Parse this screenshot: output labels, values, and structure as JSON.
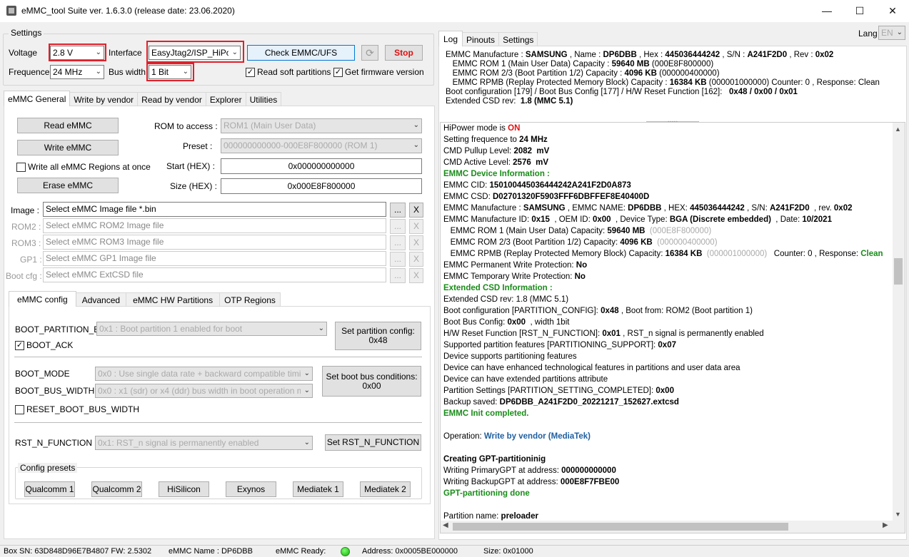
{
  "window": {
    "title": "eMMC_tool Suite  ver. 1.6.3.0 (release date: 23.06.2020)",
    "minimize": "—",
    "maximize": "☐",
    "close": "✕"
  },
  "settings": {
    "legend": "Settings",
    "voltage_label": "Voltage",
    "voltage_value": "2.8 V",
    "interface_label": "Interface",
    "interface_value": "EasyJtag2/ISP_HiPow",
    "check_button": "Check EMMC/UFS",
    "stop_button": "Stop",
    "frequence_label": "Frequence",
    "frequence_value": "24 MHz",
    "bus_width_label": "Bus width",
    "bus_width_value": "1 Bit",
    "read_soft_partitions": "Read soft partitions",
    "get_firmware_version": "Get firmware version"
  },
  "main_tabs": [
    "eMMC General",
    "Write by vendor",
    "Read by vendor",
    "Explorer",
    "Utilities"
  ],
  "general": {
    "read_button": "Read eMMC",
    "write_button": "Write eMMC",
    "write_all_regions": "Write all eMMC Regions at once",
    "erase_button": "Erase eMMC",
    "rom_label": "ROM to access :",
    "rom_value": "ROM1 (Main User Data)",
    "preset_label": "Preset :",
    "preset_value": "000000000000-000E8F800000 (ROM 1)",
    "start_label": "Start (HEX) :",
    "start_value": "0x000000000000",
    "size_label": "Size (HEX) :",
    "size_value": "0x000E8F800000",
    "files": [
      {
        "label": "Image :",
        "placeholder": "Select eMMC Image file *.bin"
      },
      {
        "label": "ROM2 :",
        "placeholder": "Select eMMC ROM2 Image file"
      },
      {
        "label": "ROM3 :",
        "placeholder": "Select eMMC ROM3 Image file"
      },
      {
        "label": "GP1 :",
        "placeholder": "Select eMMC GP1 Image file"
      },
      {
        "label": "Boot cfg :",
        "placeholder": "Select eMMC ExtCSD file"
      }
    ],
    "browse": "...",
    "clear": "X"
  },
  "config_tabs": [
    "eMMC config",
    "Advanced",
    "eMMC HW Partitions",
    "OTP Regions"
  ],
  "config": {
    "boot_partition_label": "BOOT_PARTITION_EN",
    "boot_partition_value": "0x1 : Boot partition 1 enabled for boot",
    "boot_ack": "BOOT_ACK",
    "set_partition_button": "Set partition config:\n0x48",
    "boot_mode_label": "BOOT_MODE",
    "boot_mode_value": "0x0 : Use single data rate + backward compatible timings in",
    "boot_bus_width_label": "BOOT_BUS_WIDTH",
    "boot_bus_width_value": "0x0 : x1 (sdr) or x4 (ddr) bus width in boot operation mode",
    "set_boot_bus_button": "Set boot bus conditions:\n0x00",
    "reset_boot_bus_width": "RESET_BOOT_BUS_WIDTH",
    "rst_n_label": "RST_N_FUNCTION",
    "rst_n_value": "0x1: RST_n signal is permanently enabled",
    "set_rst_button": "Set RST_N_FUNCTION",
    "presets_legend": "Config presets",
    "presets": [
      "Qualcomm 1",
      "Qualcomm 2",
      "HiSilicon",
      "Exynos",
      "Mediatek 1",
      "Mediatek 2"
    ]
  },
  "right_tabs": [
    "Log",
    "Pinouts",
    "Settings"
  ],
  "lang": {
    "label": "Lang",
    "value": "EN"
  },
  "summary": [
    [
      {
        "t": "EMMC Manufacture : "
      },
      {
        "t": "SAMSUNG",
        "c": "b"
      },
      {
        "t": " , Name : "
      },
      {
        "t": "DP6DBB",
        "c": "b"
      },
      {
        "t": " , Hex : "
      },
      {
        "t": "445036444242",
        "c": "b"
      },
      {
        "t": " , S/N : "
      },
      {
        "t": "A241F2D0",
        "c": "b"
      },
      {
        "t": " , Rev : "
      },
      {
        "t": "0x02",
        "c": "b"
      }
    ],
    [
      {
        "t": "   EMMC ROM 1 (Main User Data) Capacity : "
      },
      {
        "t": "59640 MB",
        "c": "b"
      },
      {
        "t": " (000E8F800000)"
      }
    ],
    [
      {
        "t": "   EMMC ROM 2/3 (Boot Partition 1/2) Capacity : "
      },
      {
        "t": "4096 KB",
        "c": "b"
      },
      {
        "t": " (000000400000)"
      }
    ],
    [
      {
        "t": "   EMMC RPMB (Replay Protected Memory Block) Capacity : "
      },
      {
        "t": "16384 KB",
        "c": "b"
      },
      {
        "t": " (000001000000) Counter: 0 , Response: Clean"
      }
    ],
    [
      {
        "t": "Boot configuration [179] / Boot Bus Config [177] / H/W Reset Function [162]: "
      },
      {
        "t": "  0x48 / 0x00 / 0x01",
        "c": "b"
      }
    ],
    [
      {
        "t": "Extended CSD rev: "
      },
      {
        "t": " 1.8 (MMC 5.1)",
        "c": "b"
      }
    ]
  ],
  "log": [
    [
      {
        "t": "HiPower mode is "
      },
      {
        "t": "ON",
        "c": "redt"
      }
    ],
    [
      {
        "t": "Setting frequence to "
      },
      {
        "t": "24 MHz",
        "c": "b"
      }
    ],
    [
      {
        "t": "CMD Pullup Level: "
      },
      {
        "t": "2082  mV",
        "c": "b"
      }
    ],
    [
      {
        "t": "CMD Active Level: "
      },
      {
        "t": "2576  mV",
        "c": "b"
      }
    ],
    [
      {
        "t": "EMMC Device Information :",
        "c": "green"
      }
    ],
    [
      {
        "t": "EMMC CID: "
      },
      {
        "t": "150100445036444242A241F2D0A873",
        "c": "b"
      }
    ],
    [
      {
        "t": "EMMC CSD: "
      },
      {
        "t": "D02701320F5903FFF6DBFFEF8E40400D",
        "c": "b"
      }
    ],
    [
      {
        "t": "EMMC Manufacture : "
      },
      {
        "t": "SAMSUNG",
        "c": "b"
      },
      {
        "t": " , EMMC NAME: "
      },
      {
        "t": "DP6DBB",
        "c": "b"
      },
      {
        "t": " , HEX: "
      },
      {
        "t": "445036444242",
        "c": "b"
      },
      {
        "t": " , S/N: "
      },
      {
        "t": "A241F2D0",
        "c": "b"
      },
      {
        "t": "  , rev. "
      },
      {
        "t": "0x02",
        "c": "b"
      }
    ],
    [
      {
        "t": "EMMC Manufacture ID: "
      },
      {
        "t": "0x15",
        "c": "b"
      },
      {
        "t": "  , OEM ID: "
      },
      {
        "t": "0x00",
        "c": "b"
      },
      {
        "t": "  , Device Type: "
      },
      {
        "t": "BGA (Discrete embedded)",
        "c": "b"
      },
      {
        "t": "  , Date: "
      },
      {
        "t": "10/2021",
        "c": "b"
      }
    ],
    [
      {
        "t": "   EMMC ROM 1 (Main User Data) Capacity: "
      },
      {
        "t": "59640 MB",
        "c": "b"
      },
      {
        "t": "  (000E8F800000)",
        "c": "gray"
      }
    ],
    [
      {
        "t": "   EMMC ROM 2/3 (Boot Partition 1/2) Capacity: "
      },
      {
        "t": "4096 KB",
        "c": "b"
      },
      {
        "t": "  (000000400000)",
        "c": "gray"
      }
    ],
    [
      {
        "t": "   EMMC RPMB (Replay Protected Memory Block) Capacity: "
      },
      {
        "t": "16384 KB",
        "c": "b"
      },
      {
        "t": "  (000001000000)",
        "c": "gray"
      },
      {
        "t": "   Counter: 0 , Response: "
      },
      {
        "t": "Clean",
        "c": "green"
      }
    ],
    [
      {
        "t": "EMMC Permanent Write Protection: "
      },
      {
        "t": "No",
        "c": "b"
      }
    ],
    [
      {
        "t": "EMMC Temporary Write Protection: "
      },
      {
        "t": "No",
        "c": "b"
      }
    ],
    [
      {
        "t": "Extended CSD Information :",
        "c": "green"
      }
    ],
    [
      {
        "t": "Extended CSD rev: 1.8 (MMC 5.1)"
      }
    ],
    [
      {
        "t": "Boot configuration [PARTITION_CONFIG]: "
      },
      {
        "t": "0x48",
        "c": "b"
      },
      {
        "t": " , Boot from: ROM2 (Boot partition 1)"
      }
    ],
    [
      {
        "t": "Boot Bus Config: "
      },
      {
        "t": "0x00",
        "c": "b"
      },
      {
        "t": "  , width 1bit"
      }
    ],
    [
      {
        "t": "H/W Reset Function [RST_N_FUNCTION]: "
      },
      {
        "t": "0x01",
        "c": "b"
      },
      {
        "t": " , RST_n signal is permanently enabled"
      }
    ],
    [
      {
        "t": "Supported partition features [PARTITIONING_SUPPORT]: "
      },
      {
        "t": "0x07",
        "c": "b"
      }
    ],
    [
      {
        "t": "Device supports partitioning features"
      }
    ],
    [
      {
        "t": "Device can have enhanced technological features in partitions and user data area"
      }
    ],
    [
      {
        "t": "Device can have extended partitions attribute"
      }
    ],
    [
      {
        "t": "Partition Settings [PARTITION_SETTING_COMPLETED]: "
      },
      {
        "t": "0x00",
        "c": "b"
      }
    ],
    [
      {
        "t": "Backup saved: "
      },
      {
        "t": "DP6DBB_A241F2D0_20221217_152627.extcsd",
        "c": "b"
      }
    ],
    [
      {
        "t": "EMMC Init completed.",
        "c": "green"
      }
    ],
    [],
    [
      {
        "t": "Operation: "
      },
      {
        "t": "Write by vendor (MediaTek)",
        "c": "blue"
      }
    ],
    [],
    [
      {
        "t": "Creating GPT-partitioninig",
        "c": "b"
      }
    ],
    [
      {
        "t": "Writing PrimaryGPT at address: "
      },
      {
        "t": "000000000000",
        "c": "b"
      }
    ],
    [
      {
        "t": "Writing BackupGPT at address: "
      },
      {
        "t": "000E8F7FBE00",
        "c": "b"
      }
    ],
    [
      {
        "t": "GPT-partitioning done",
        "c": "green"
      }
    ],
    [],
    [
      {
        "t": "Partition name: "
      },
      {
        "t": "preloader",
        "c": "b"
      }
    ]
  ],
  "statusbar": {
    "box_sn": "Box SN:  63D848D96E7B4807  FW:  2.5302",
    "emmc_name": "eMMC Name : DP6DBB",
    "emmc_ready": "eMMC Ready:",
    "address": "Address: 0x0005BE000000",
    "size": "Size: 0x01000"
  }
}
